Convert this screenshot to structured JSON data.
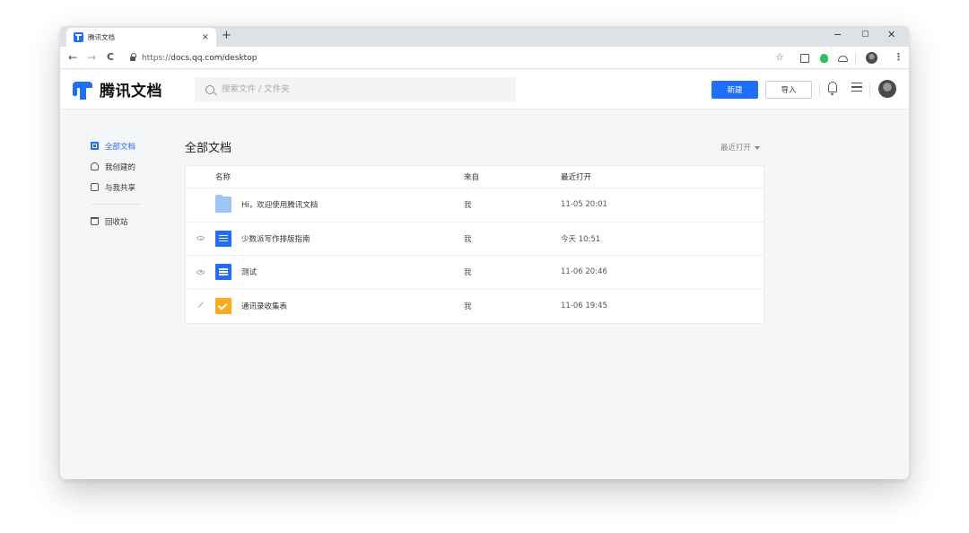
{
  "browser": {
    "tab_title": "腾讯文档",
    "tab_close": "×",
    "new_tab": "+",
    "win_minimize": "−",
    "win_restore": "▢",
    "win_close": "✕",
    "nav_back": "←",
    "nav_forward": "→",
    "nav_reload": "C",
    "url_prefix": "https://",
    "url_rest": "docs.qq.com/desktop",
    "ext_star": "☆",
    "ext_more": "⋮"
  },
  "header": {
    "logo_text": "腾讯文档",
    "search_placeholder": "搜索文件 / 文件夹",
    "new_button": "新建",
    "import_button": "导入"
  },
  "sidebar": {
    "items": [
      {
        "label": "全部文档",
        "icon": "docs-icon",
        "active": true
      },
      {
        "label": "我创建的",
        "icon": "person-icon"
      },
      {
        "label": "与我共享",
        "icon": "share-icon"
      },
      {
        "label": "回收站",
        "icon": "trash-icon"
      }
    ]
  },
  "main": {
    "title": "全部文档",
    "sort_label": "最近打开",
    "columns": {
      "name": "名称",
      "from": "来自",
      "time": "最近打开"
    },
    "rows": [
      {
        "status": "",
        "type": "folder",
        "name": "Hi，欢迎使用腾讯文档",
        "from": "我",
        "time": "11-05 20:01"
      },
      {
        "status": "view",
        "type": "doc",
        "name": "少数派写作排版指南",
        "from": "我",
        "time": "今天 10:51"
      },
      {
        "status": "view",
        "type": "doc",
        "name": "测试",
        "from": "我",
        "time": "11-06 20:46"
      },
      {
        "status": "edit",
        "type": "form",
        "name": "通讯录收集表",
        "from": "我",
        "time": "11-06 19:45"
      }
    ]
  },
  "colors": {
    "accent": "#1e6fff",
    "folder": "#9cc6f5",
    "form": "#ffaa1a"
  }
}
